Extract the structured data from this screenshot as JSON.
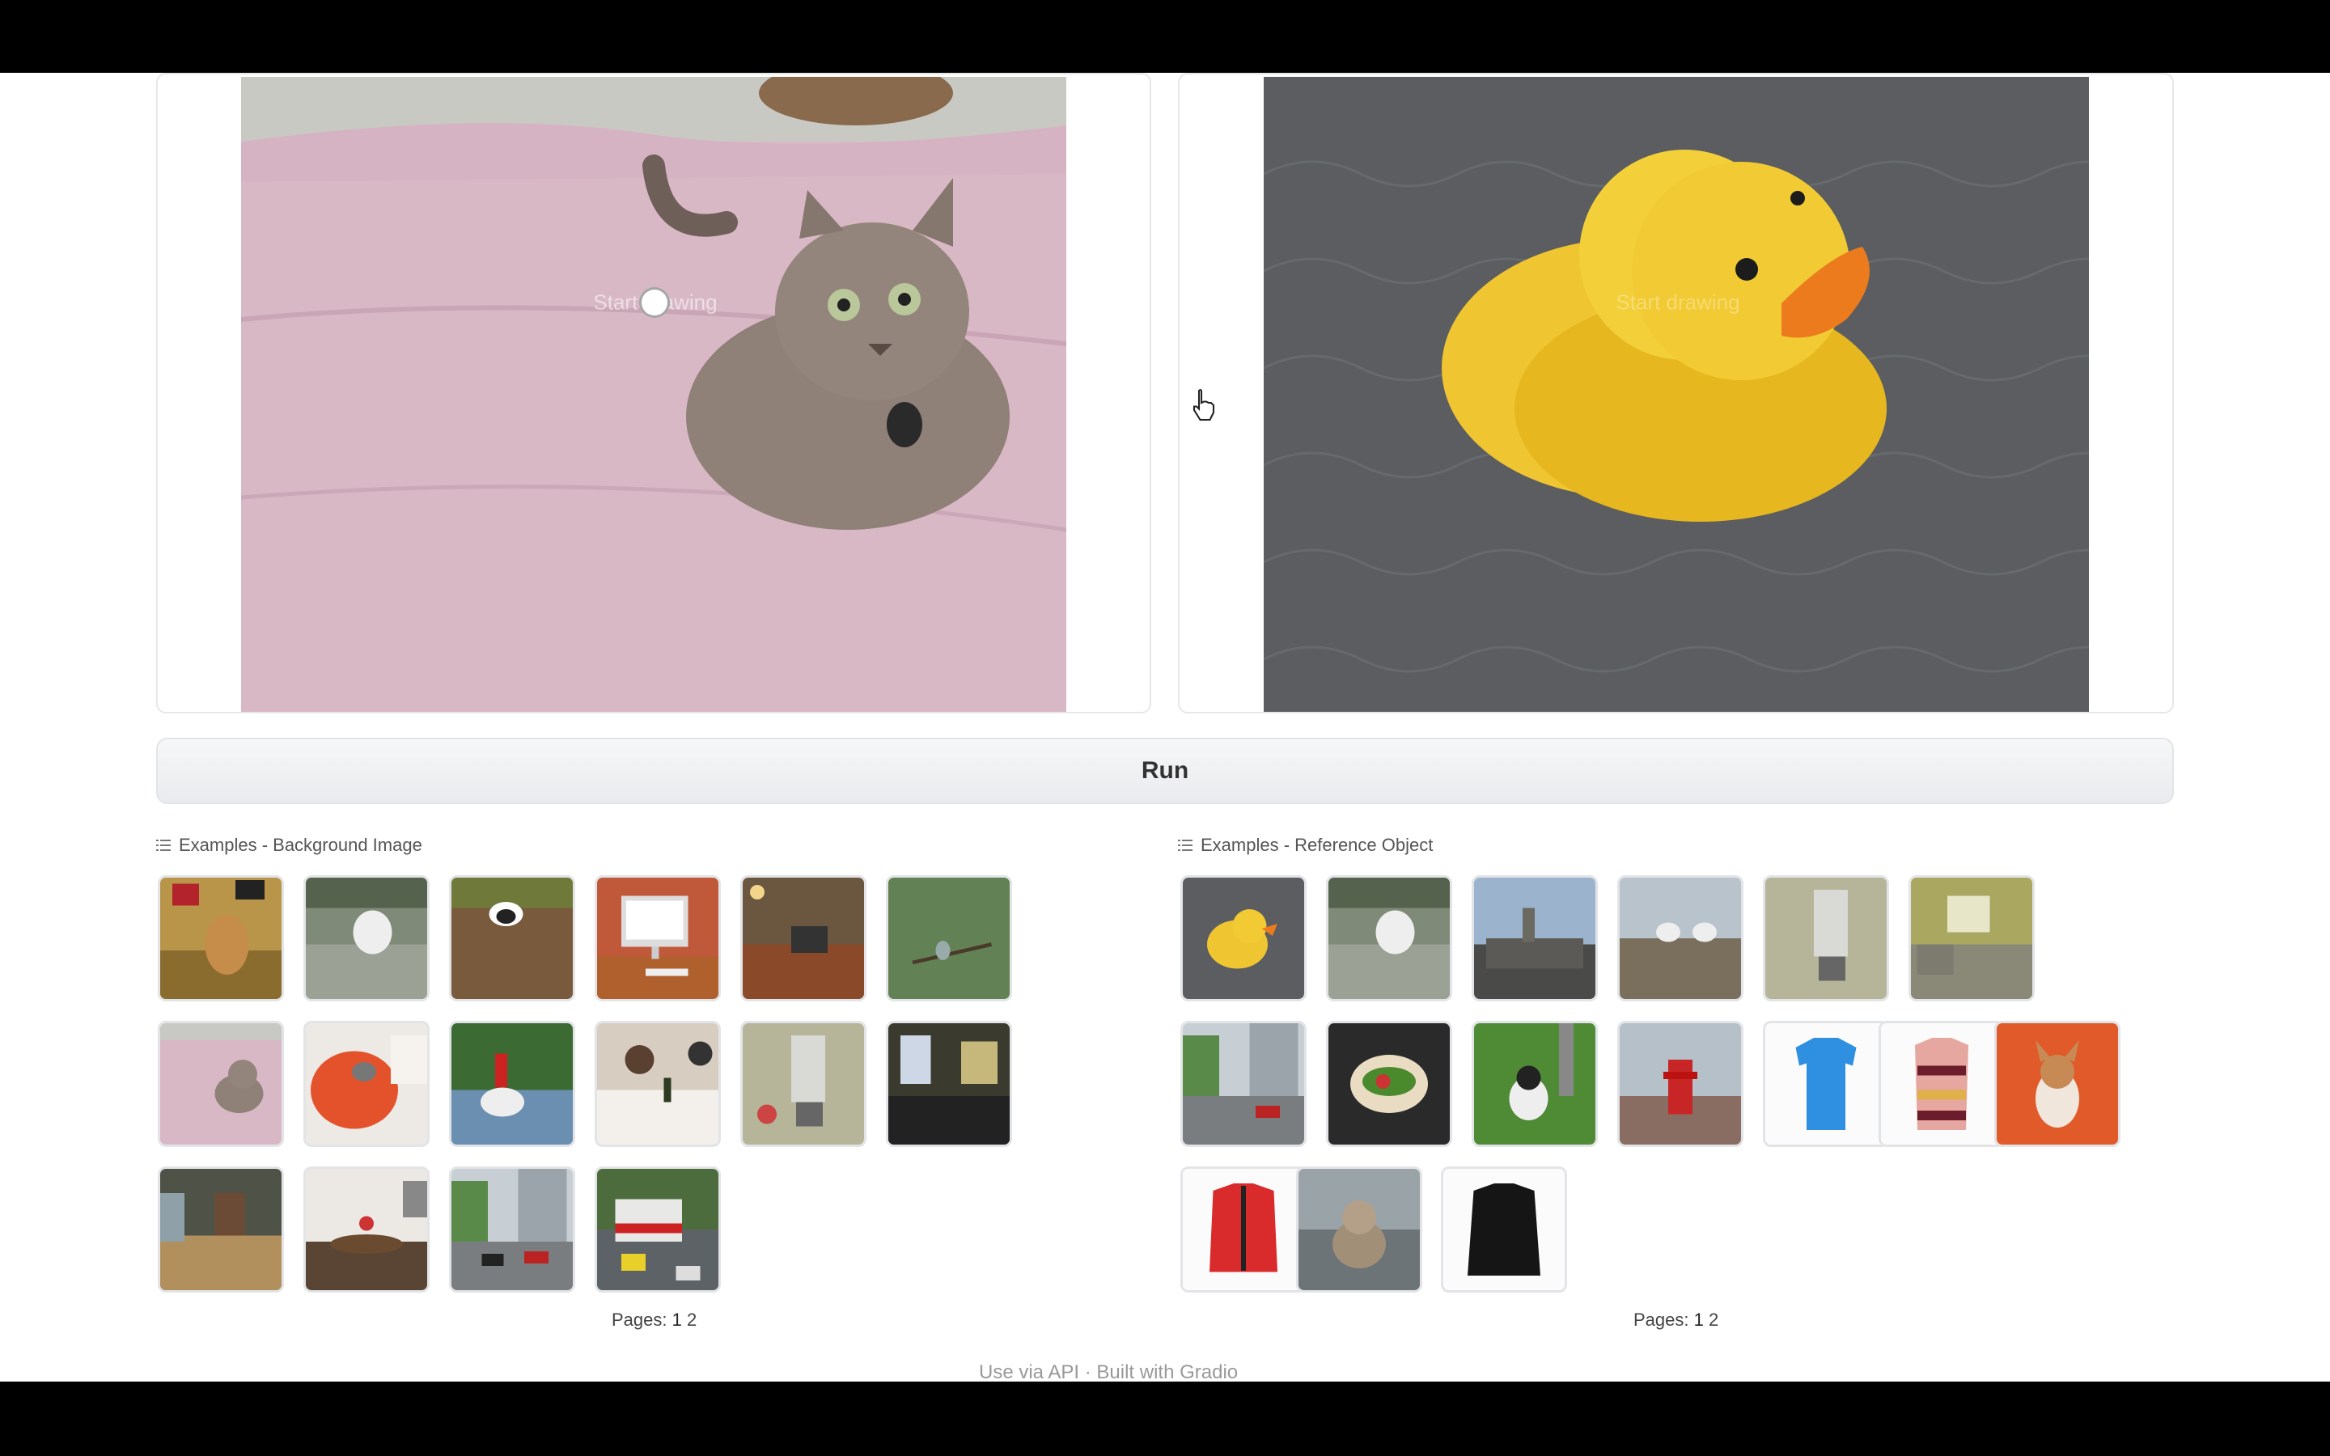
{
  "editor_left": {
    "hint": "Start drawing"
  },
  "editor_right": {
    "hint": "Start drawing"
  },
  "run_button": {
    "label": "Run"
  },
  "examples_background": {
    "label": "Examples - Background Image",
    "pages_label": "Pages:",
    "pages": [
      "1",
      "2"
    ]
  },
  "examples_reference": {
    "label": "Examples - Reference Object",
    "pages_label": "Pages:",
    "pages": [
      "1",
      "2"
    ]
  },
  "footer": {
    "text": "Use via API  ·  Built with Gradio"
  },
  "colors": {
    "page_bg": "#ffffff",
    "button_bg": "#eceef0",
    "border": "#e2e4e7"
  }
}
